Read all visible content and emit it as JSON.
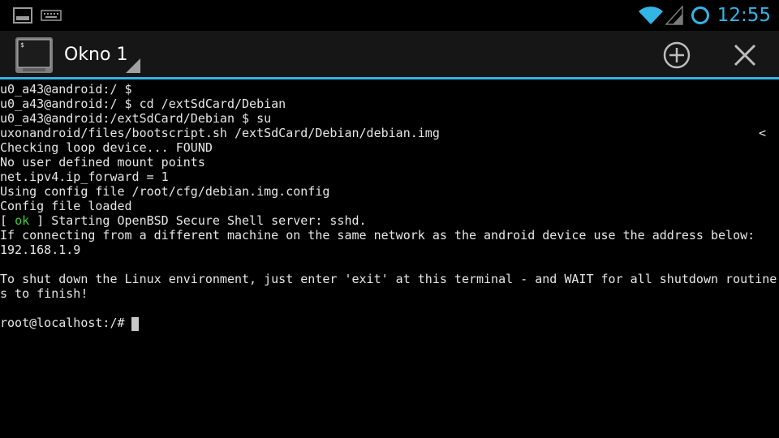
{
  "status_bar": {
    "time": "12:55",
    "icons": [
      "terminal-notification-icon",
      "keyboard-notification-icon",
      "wifi-icon",
      "signal-icon",
      "sync-ring-icon"
    ],
    "accent_color": "#33b5e5"
  },
  "action_bar": {
    "window_title": "Okno 1",
    "buttons": [
      "new-window-icon",
      "close-window-icon"
    ]
  },
  "terminal": {
    "lines": [
      "u0_a43@android:/ $",
      "u0_a43@android:/ $ cd /extSdCard/Debian",
      "u0_a43@android:/extSdCard/Debian $ su",
      "uxonandroid/files/bootscript.sh /extSdCard/Debian/debian.img",
      "Checking loop device... FOUND",
      "No user defined mount points",
      "net.ipv4.ip_forward = 1",
      "Using config file /root/cfg/debian.img.config",
      "Config file loaded",
      "",
      "If connecting from a different machine on the same network as the android device use the address below:",
      "192.168.1.9",
      "",
      "To shut down the Linux environment, just enter 'exit' at this terminal - and WAIT for all shutdown routine",
      "s to finish!",
      "",
      "root@localhost:/# "
    ],
    "ok_line": {
      "open": "[ ",
      "ok": "ok",
      "rest": " ] Starting OpenBSD Secure Shell server: sshd."
    },
    "wrap_marker": "<",
    "ok_color": "#3ad13a"
  }
}
